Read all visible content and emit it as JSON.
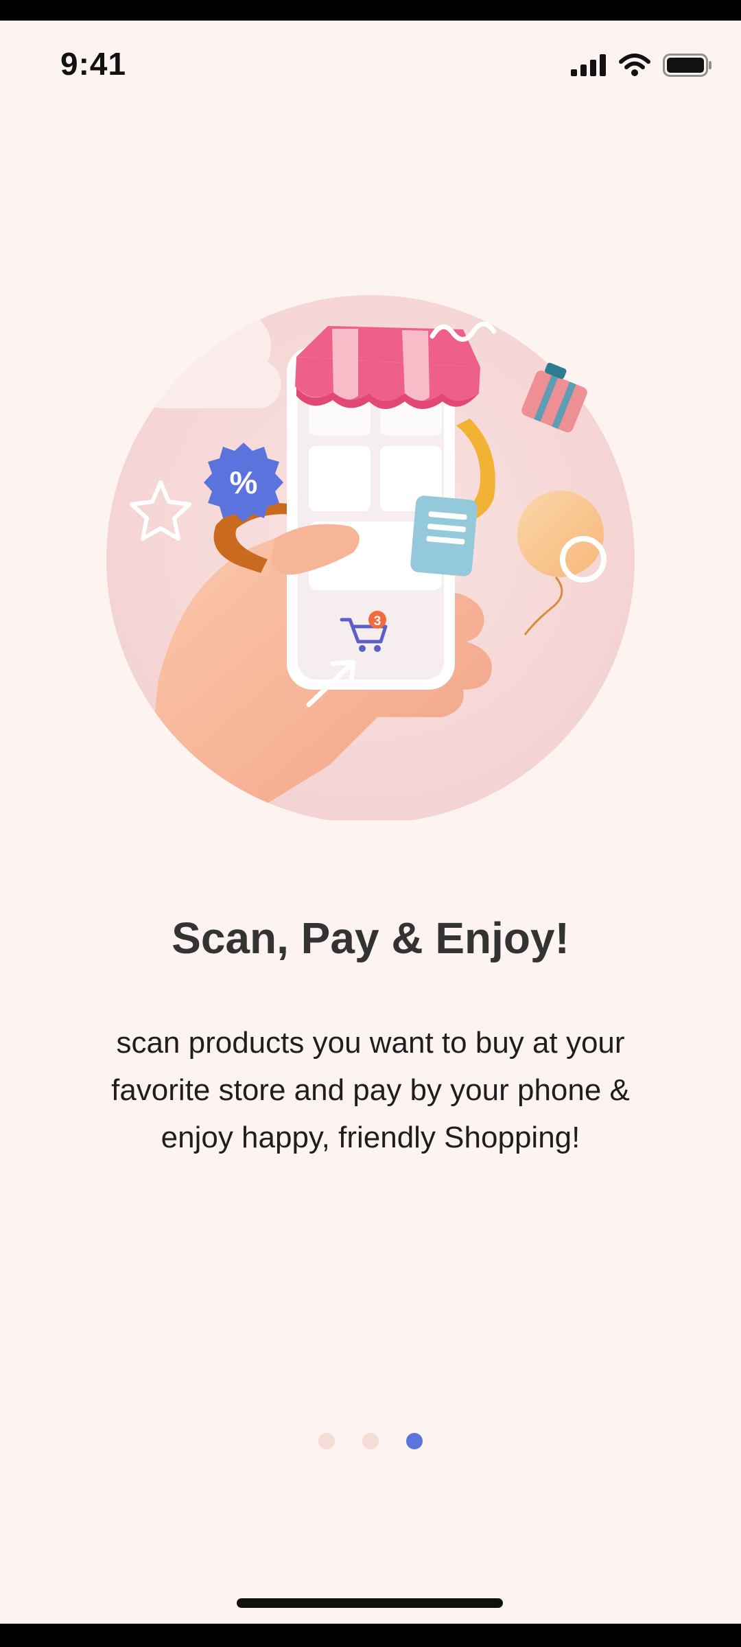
{
  "status_bar": {
    "time": "9:41",
    "icons": [
      "cellular-signal-icon",
      "wifi-icon",
      "battery-icon"
    ]
  },
  "onboarding": {
    "title": "Scan, Pay & Enjoy!",
    "description": "scan products you want to buy at your favorite store and pay by your phone & enjoy happy, friendly Shopping!",
    "illustration": {
      "discount_badge_text": "%",
      "cart_badge_count": "3"
    }
  },
  "pager": {
    "total": 3,
    "active_index": 2
  },
  "colors": {
    "background": "#fdf4f2",
    "accent": "#5b74dd",
    "inactive_dot": "#f7dbd6",
    "title_text": "#333333",
    "body_text": "#1e1e1e",
    "awning_pink": "#ef5f8b"
  }
}
